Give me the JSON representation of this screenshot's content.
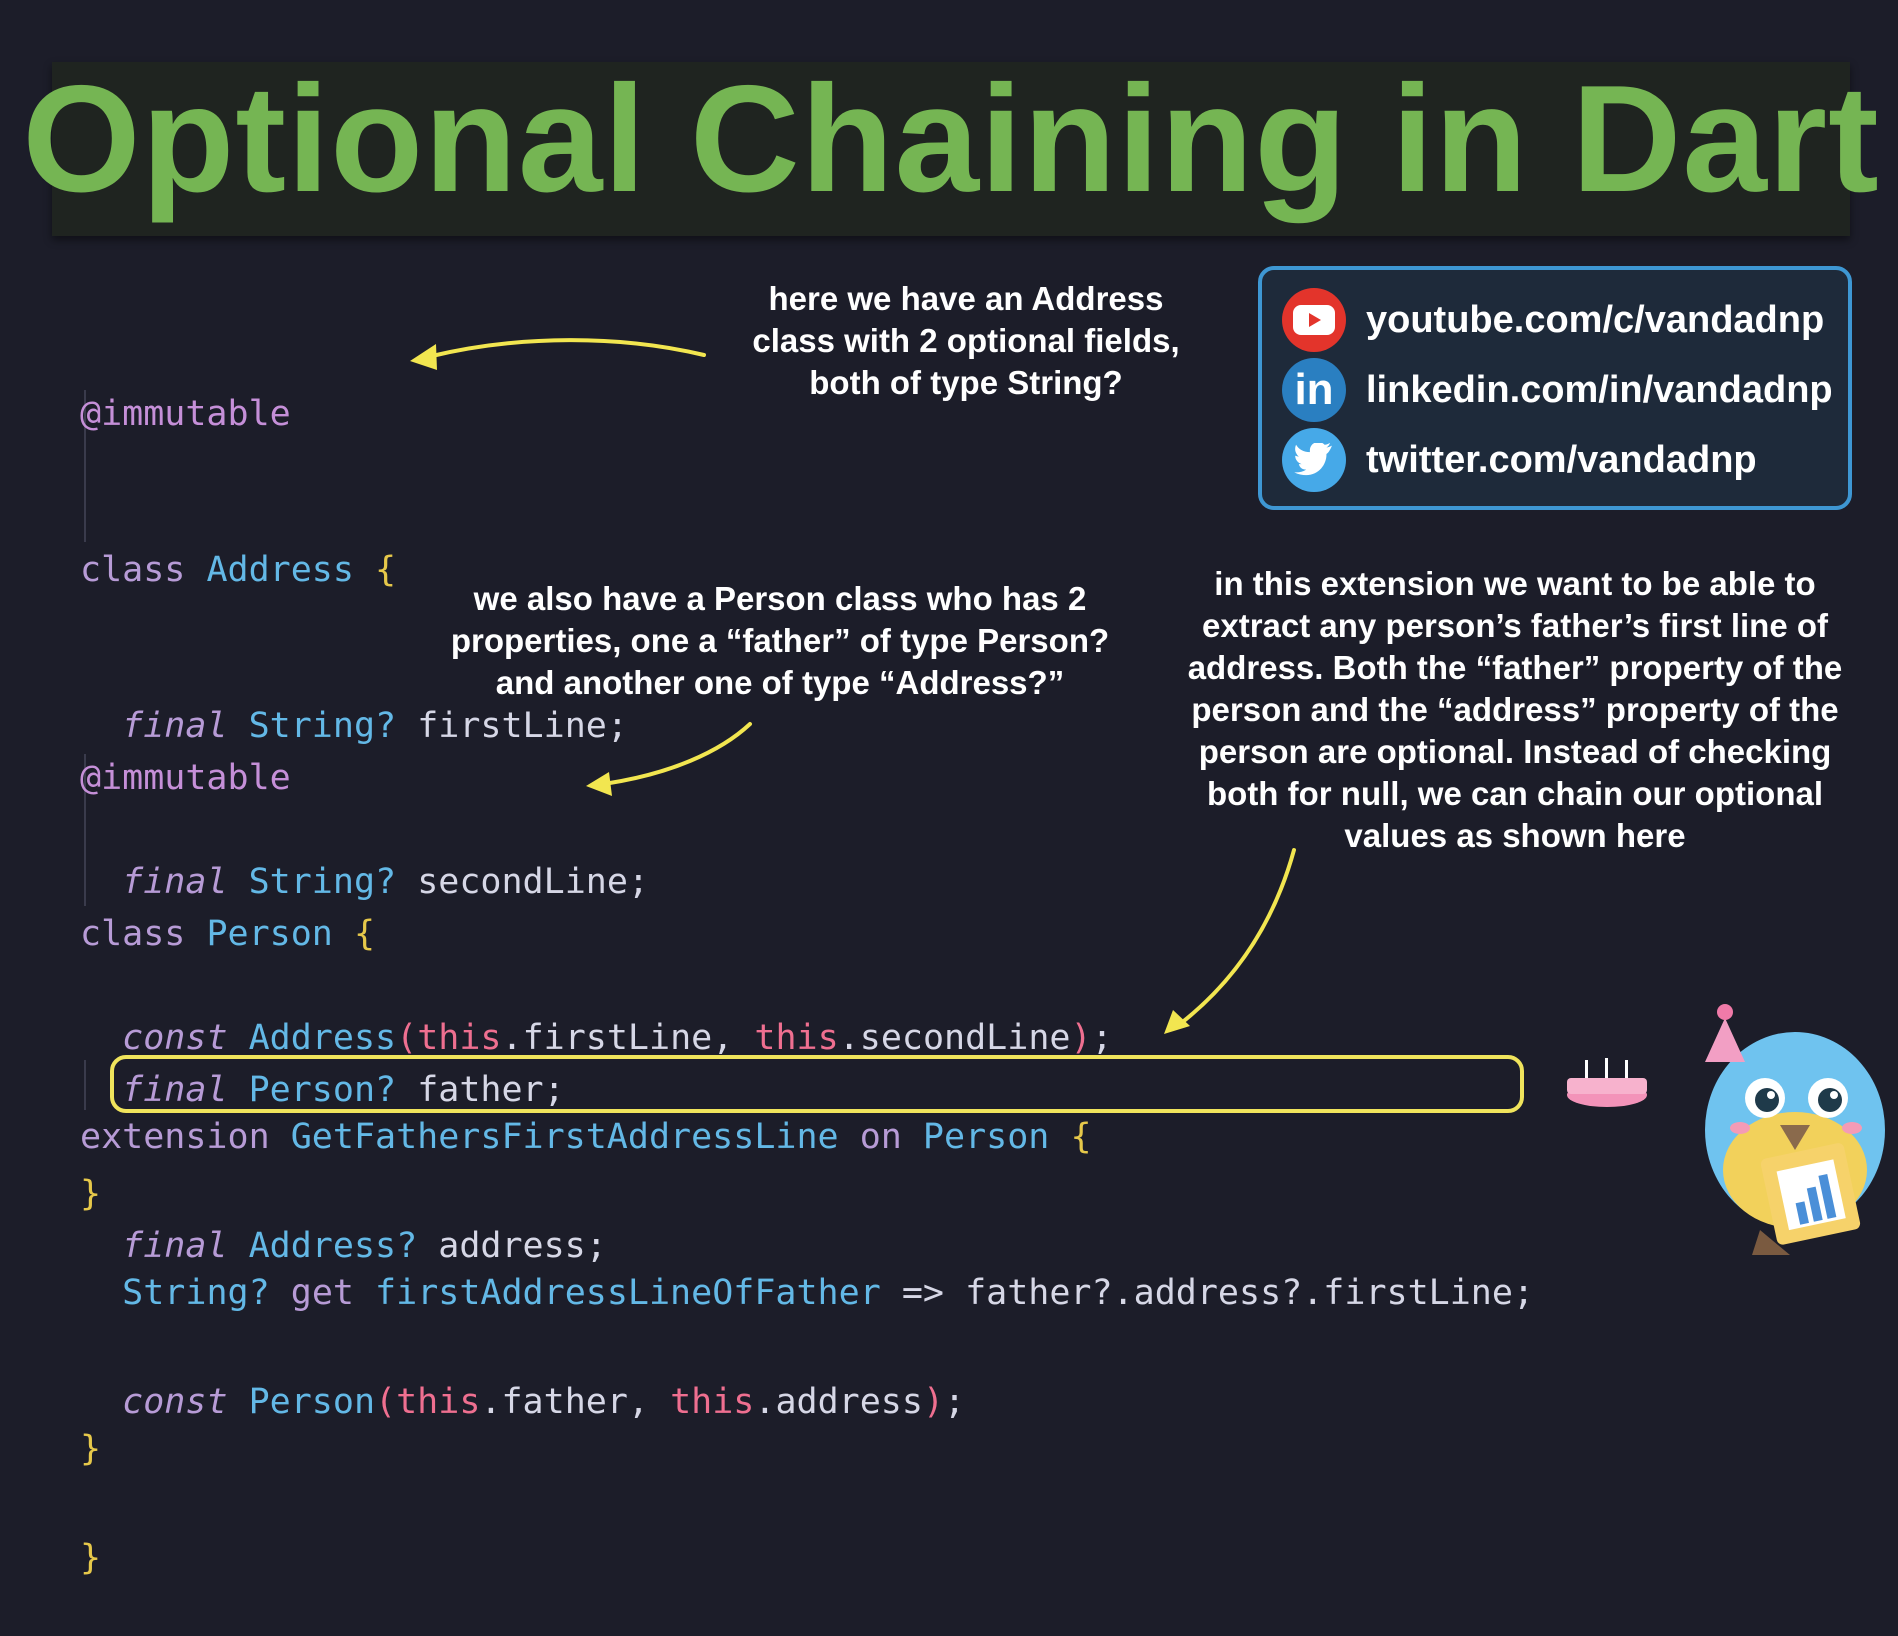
{
  "title": "Optional Chaining in Dart",
  "social": {
    "youtube": "youtube.com/c/vandadnp",
    "linkedin": "linkedin.com/in/vandadnp",
    "linkedin_glyph": "in",
    "twitter": "twitter.com/vandadnp",
    "icons": [
      "youtube-icon",
      "linkedin-icon",
      "twitter-icon"
    ],
    "colors": {
      "youtube": "#e3342b",
      "linkedin": "#2a7fc1",
      "twitter": "#46a9e8",
      "border": "#3e97d3"
    }
  },
  "notes": {
    "address_note": "here we have an Address class with 2 optional fields, both of type String?",
    "person_note": "we also have a Person class who has 2 properties, one a “father” of type Person? and another one of type “Address?”",
    "extension_note": "in this extension we want to be able to extract any person’s father’s first line of address. Both the “father” property of the person and the “address” property of the person are optional. Instead of checking both for null, we can chain our optional values as shown here"
  },
  "code": {
    "annotation": "@immutable",
    "kw_class": "class",
    "kw_final": "final",
    "kw_const": "const",
    "kw_extension": "extension",
    "kw_on": "on",
    "kw_this": "this",
    "kw_get": "get",
    "open_brace": "{",
    "close_brace": "}",
    "address_class": "Address",
    "person_class": "Person",
    "string_type": "String?",
    "address_type": "Address?",
    "person_type": "Person?",
    "first_line": "firstLine",
    "second_line": "secondLine",
    "father": "father",
    "address": "address",
    "extension_name": "GetFathersFirstAddressLine",
    "getter_name": "firstAddressLineOfFather",
    "getter_body": "=> father?.address?.firstLine;"
  },
  "colors": {
    "background": "#1c1d29",
    "title_green": "#75b553",
    "highlight_yellow": "#f0e45c",
    "arrow_yellow": "#f2e650"
  }
}
